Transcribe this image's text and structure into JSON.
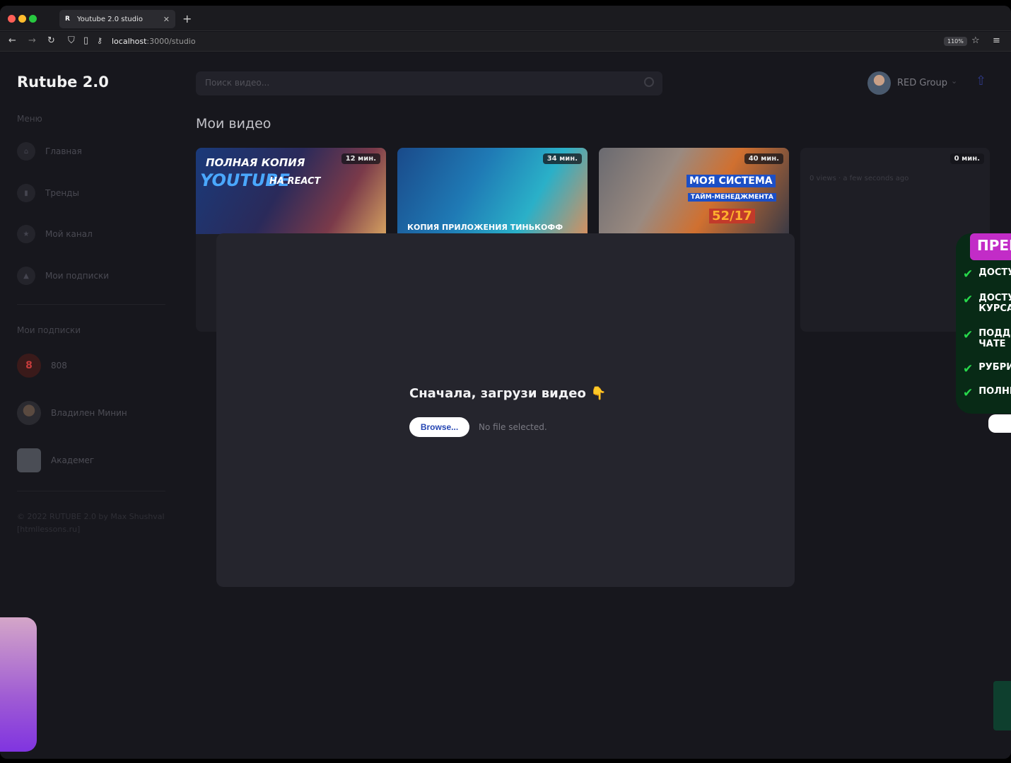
{
  "browser": {
    "tab_title": "Youtube 2.0 studio",
    "tab_favicon": "R",
    "url_host": "localhost",
    "url_path": ":3000/studio",
    "zoom": "110%"
  },
  "app": {
    "logo": "Rutube 2.0",
    "search_placeholder": "Поиск видео...",
    "user_name": "RED Group"
  },
  "sidebar": {
    "menu_label": "Меню",
    "items": [
      {
        "label": "Главная",
        "icon": "home-icon"
      },
      {
        "label": "Тренды",
        "icon": "chart-icon"
      },
      {
        "label": "Мой канал",
        "icon": "star-icon"
      },
      {
        "label": "Мои подписки",
        "icon": "subscriptions-icon"
      }
    ],
    "subs_label": "Мои подписки",
    "subscriptions": [
      {
        "name": "808",
        "avatar": "8"
      },
      {
        "name": "Владилен Минин",
        "avatar": ""
      },
      {
        "name": "Академег",
        "avatar": ""
      }
    ],
    "copyright": "© 2022 RUTUBE 2.0 by Max Shushval [htmllessons.ru]"
  },
  "main": {
    "title": "Мои видео",
    "videos": [
      {
        "duration": "12 мин.",
        "thumb_line1": "ПОЛНАЯ КОПИЯ",
        "thumb_line2": "YOUTUBE",
        "thumb_line3": "НА REACT"
      },
      {
        "duration": "34 мин.",
        "thumb_line1": "КОПИЯ ПРИЛОЖЕНИЯ ТИНЬКОФФ БАНК"
      },
      {
        "duration": "40 мин.",
        "thumb_line1": "МОЯ СИСТЕМА",
        "thumb_line2": "ТАЙМ-МЕНЕДЖМЕНТА",
        "thumb_line3": "52/17"
      },
      {
        "duration": "0 мин.",
        "views": "0 views",
        "date": "a few seconds ago"
      }
    ]
  },
  "modal": {
    "heading": "Сначала, загрузи видео 👇",
    "browse_label": "Browse...",
    "file_status": "No file selected."
  },
  "promo": {
    "header": "ПРЕМ",
    "lines": [
      "ДОСТУ",
      "ДОСТУ КУРСА",
      "ПОДДЕ ЧАТЕ",
      "РУБРИ",
      "ПОЛНЫ"
    ]
  }
}
